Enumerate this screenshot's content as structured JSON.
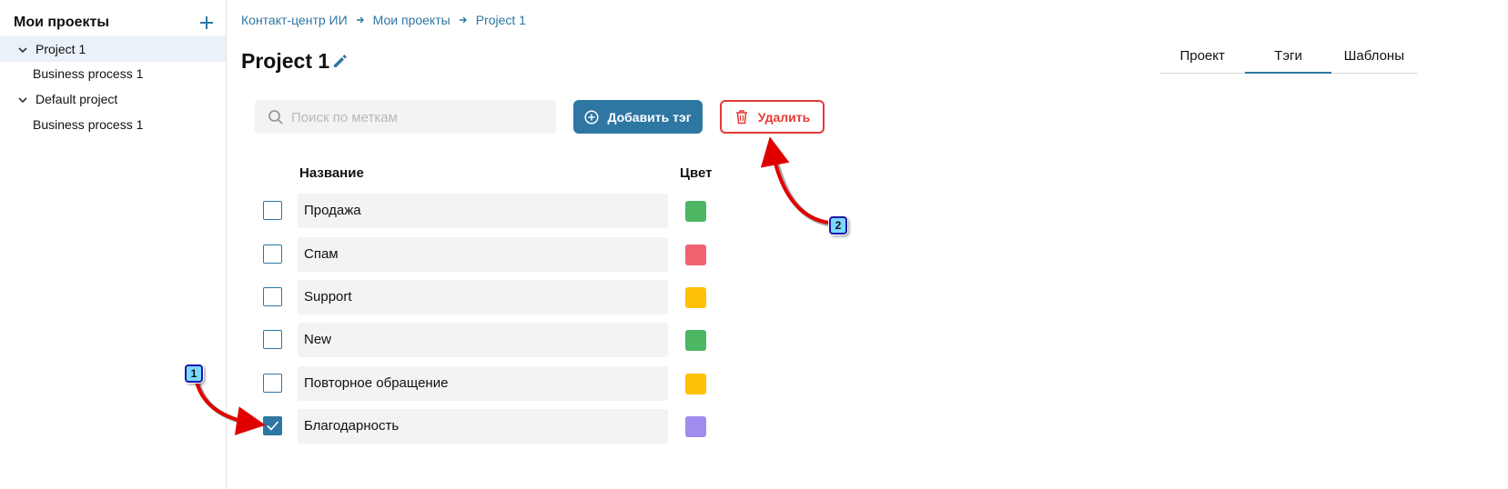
{
  "sidebar": {
    "title": "Мои проекты",
    "add_icon": "plus-icon",
    "items": [
      {
        "label": "Project 1",
        "type": "project",
        "expanded": true,
        "active": true
      },
      {
        "label": "Business process 1",
        "type": "process"
      },
      {
        "label": "Default project",
        "type": "project",
        "expanded": true
      },
      {
        "label": "Business process 1",
        "type": "process"
      }
    ]
  },
  "breadcrumb": [
    "Контакт-центр ИИ",
    "Мои проекты",
    "Project 1"
  ],
  "page": {
    "title": "Project 1"
  },
  "tabs": [
    {
      "label": "Проект"
    },
    {
      "label": "Тэги",
      "active": true
    },
    {
      "label": "Шаблоны"
    }
  ],
  "toolbar": {
    "search_placeholder": "Поиск по меткам",
    "add_label": "Добавить тэг",
    "delete_label": "Удалить"
  },
  "table": {
    "headers": {
      "name": "Название",
      "color": "Цвет"
    },
    "rows": [
      {
        "name": "Продажа",
        "color": "#4cb663",
        "checked": false
      },
      {
        "name": "Спам",
        "color": "#ef6370",
        "checked": false
      },
      {
        "name": "Support",
        "color": "#ffc107",
        "checked": false
      },
      {
        "name": "New",
        "color": "#4cb663",
        "checked": false
      },
      {
        "name": "Повторное обращение",
        "color": "#ffc107",
        "checked": false
      },
      {
        "name": "Благодарность",
        "color": "#a08cee",
        "checked": true
      }
    ]
  },
  "annotations": [
    {
      "number": "1",
      "points_to": "checkbox Благодарность"
    },
    {
      "number": "2",
      "points_to": "Удалить button"
    }
  ],
  "colors": {
    "accent": "#2e77a3",
    "danger": "#e53935",
    "callout_fill": "#7ad8ff",
    "arrow": "#e00000"
  }
}
